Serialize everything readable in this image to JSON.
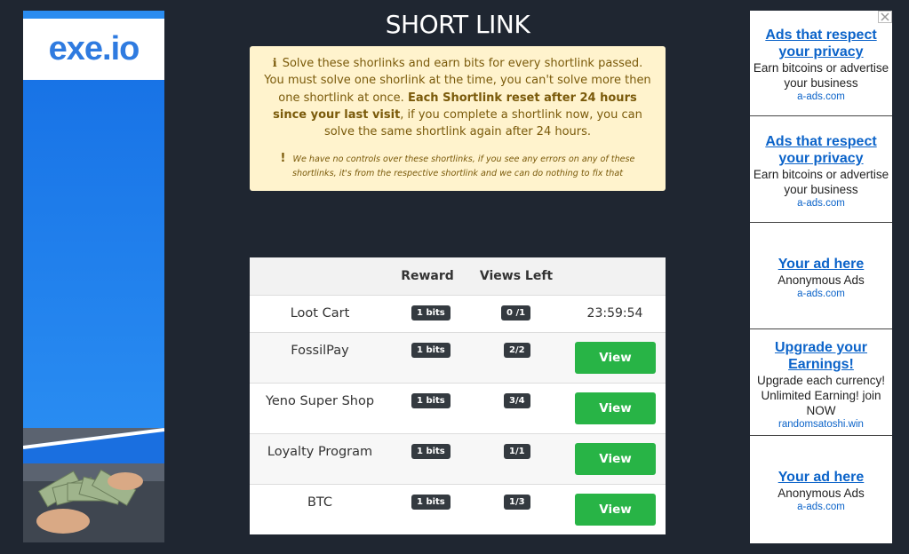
{
  "left_ad": {
    "logo": "exe.io"
  },
  "main": {
    "title": "SHORT LINK",
    "notice": {
      "part1": "Solve these shorlinks and earn bits for every shortlink passed. You must solve one shorlink at the time, you can't solve more then one shortlink at once.",
      "bold": "Each Shortlink reset after 24 hours since your last visit",
      "part2": ", if you complete a shortlink now, you can solve the same shortlink again after 24 hours.",
      "note": "We have no controls over these shortlinks, if you see any errors on any of these shortlinks, it's from the respective shortlink and we can do nothing to fix that",
      "info_icon": "info-icon",
      "warn_icon": "exclamation-icon"
    },
    "table": {
      "headers": {
        "reward": "Reward",
        "views": "Views Left"
      },
      "rows": [
        {
          "name": "Loot Cart",
          "reward": "1 bits",
          "views": "0 /1",
          "status": "23:59:54"
        },
        {
          "name": "FossilPay",
          "reward": "1 bits",
          "views": "2/2",
          "action": "View"
        },
        {
          "name": "Yeno Super Shop",
          "reward": "1 bits",
          "views": "3/4",
          "action": "View"
        },
        {
          "name": "Loyalty Program",
          "reward": "1 bits",
          "views": "1/1",
          "action": "View"
        },
        {
          "name": "BTC",
          "reward": "1 bits",
          "views": "1/3",
          "action": "View"
        }
      ]
    }
  },
  "right_ads": [
    {
      "title": "Ads that respect your privacy",
      "desc": "Earn bitcoins or advertise your business",
      "host": "a-ads.com"
    },
    {
      "title": "Ads that respect your privacy",
      "desc": "Earn bitcoins or advertise your business",
      "host": "a-ads.com"
    },
    {
      "title": "Your ad here",
      "desc": "Anonymous Ads",
      "host": "a-ads.com"
    },
    {
      "title": "Upgrade your Earnings!",
      "desc": "Upgrade each currency! Unlimited Earning! join NOW",
      "host": "randomsatoshi.win"
    },
    {
      "title": "Your ad here",
      "desc": "Anonymous Ads",
      "host": "a-ads.com"
    }
  ],
  "colors": {
    "background": "#1f2631",
    "notice_bg": "#fff3cd",
    "view_button": "#28b446",
    "badge": "#343a40",
    "ad_link": "#0b63c9"
  }
}
